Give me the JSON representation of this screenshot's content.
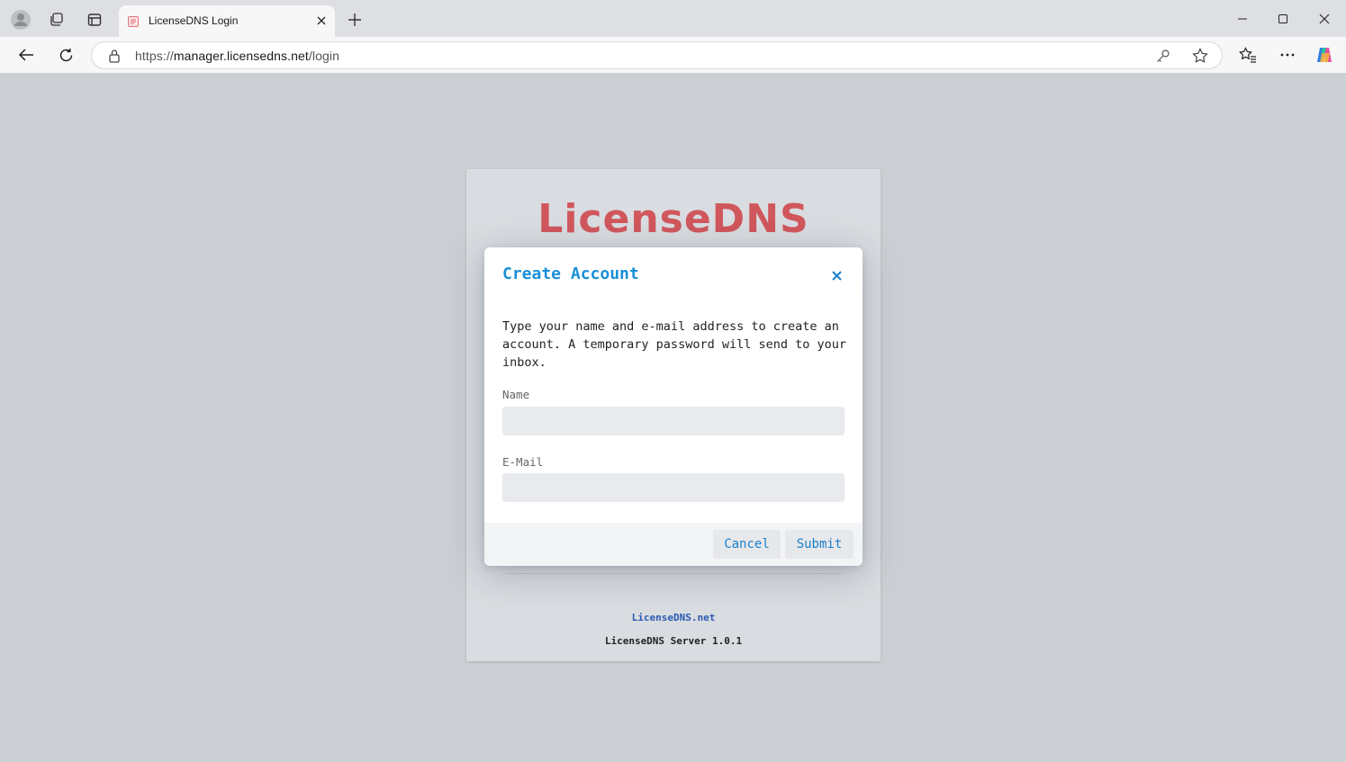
{
  "browser": {
    "tab": {
      "title": "LicenseDNS Login"
    },
    "address": {
      "scheme": "https://",
      "host": "manager.licensedns.net",
      "path": "/login"
    }
  },
  "login": {
    "brand": "LicenseDNS",
    "site_link": "LicenseDNS.net",
    "version": "LicenseDNS Server 1.0.1"
  },
  "modal": {
    "title": "Create Account",
    "description": "Type your name and e-mail address to create an account. A temporary password will send to your inbox.",
    "name_label": "Name",
    "name_value": "",
    "email_label": "E-Mail",
    "email_value": "",
    "cancel_label": "Cancel",
    "submit_label": "Submit"
  },
  "colors": {
    "brand": "#d0575c",
    "modal_title": "#1a8fd8",
    "button_text": "#1a7fc9",
    "link": "#2a5ab5"
  },
  "icons": [
    "profile-icon",
    "workspaces-icon",
    "tab-actions-icon",
    "favicon-icon",
    "close-icon",
    "plus-icon",
    "minimize-icon",
    "maximize-icon",
    "back-icon",
    "refresh-icon",
    "lock-icon",
    "key-icon",
    "star-icon",
    "favorites-icon",
    "more-icon",
    "copilot-icon"
  ]
}
